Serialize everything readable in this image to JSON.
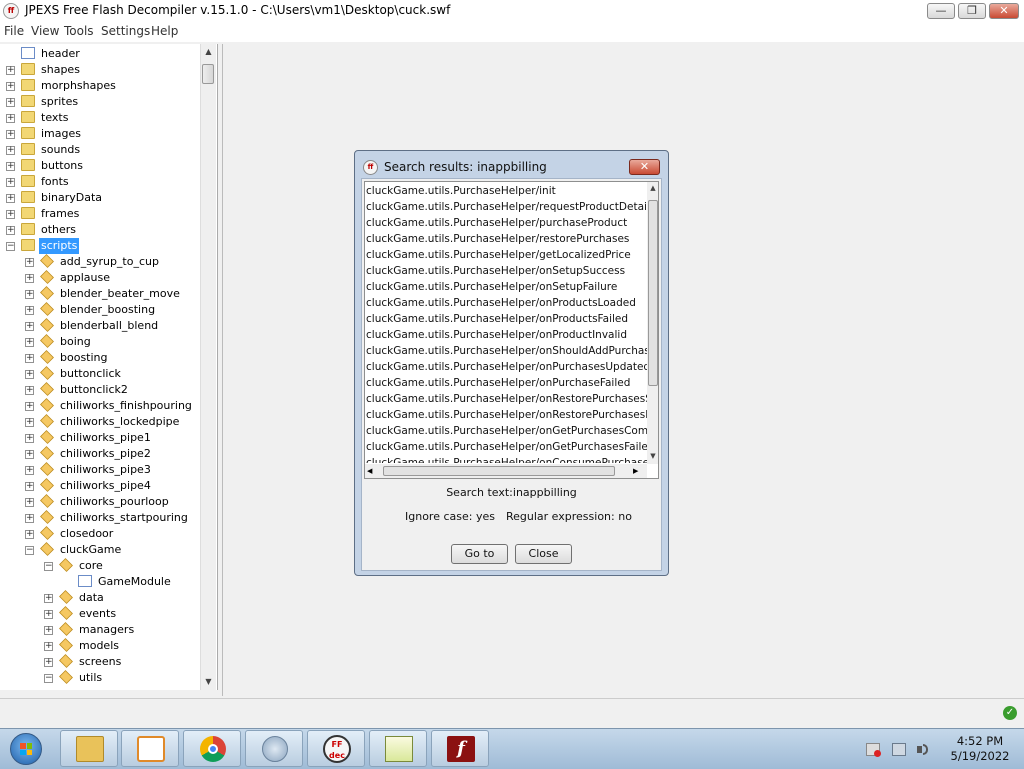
{
  "window": {
    "title": "JPEXS Free Flash Decompiler v.15.1.0 - C:\\Users\\vm1\\Desktop\\cuck.swf",
    "app_icon_text": "ff",
    "minimize": "—",
    "maximize": "❐",
    "close": "✕"
  },
  "menu": [
    "File",
    "View",
    "Tools",
    "Settings",
    "Help"
  ],
  "tree": {
    "nodes": [
      {
        "label": "header",
        "depth": 0,
        "expander": "",
        "icon": "doc"
      },
      {
        "label": "shapes",
        "depth": 0,
        "expander": "+",
        "icon": "folder"
      },
      {
        "label": "morphshapes",
        "depth": 0,
        "expander": "+",
        "icon": "folder"
      },
      {
        "label": "sprites",
        "depth": 0,
        "expander": "+",
        "icon": "folder"
      },
      {
        "label": "texts",
        "depth": 0,
        "expander": "+",
        "icon": "folder"
      },
      {
        "label": "images",
        "depth": 0,
        "expander": "+",
        "icon": "folder"
      },
      {
        "label": "sounds",
        "depth": 0,
        "expander": "+",
        "icon": "folder"
      },
      {
        "label": "buttons",
        "depth": 0,
        "expander": "+",
        "icon": "folder"
      },
      {
        "label": "fonts",
        "depth": 0,
        "expander": "+",
        "icon": "folder"
      },
      {
        "label": "binaryData",
        "depth": 0,
        "expander": "+",
        "icon": "folder"
      },
      {
        "label": "frames",
        "depth": 0,
        "expander": "+",
        "icon": "folder"
      },
      {
        "label": "others",
        "depth": 0,
        "expander": "+",
        "icon": "folder"
      },
      {
        "label": "scripts",
        "depth": 0,
        "expander": "−",
        "icon": "folder",
        "selected": true
      },
      {
        "label": "add_syrup_to_cup",
        "depth": 1,
        "expander": "+",
        "icon": "pkg"
      },
      {
        "label": "applause",
        "depth": 1,
        "expander": "+",
        "icon": "pkg"
      },
      {
        "label": "blender_beater_move",
        "depth": 1,
        "expander": "+",
        "icon": "pkg"
      },
      {
        "label": "blender_boosting",
        "depth": 1,
        "expander": "+",
        "icon": "pkg"
      },
      {
        "label": "blenderball_blend",
        "depth": 1,
        "expander": "+",
        "icon": "pkg"
      },
      {
        "label": "boing",
        "depth": 1,
        "expander": "+",
        "icon": "pkg"
      },
      {
        "label": "boosting",
        "depth": 1,
        "expander": "+",
        "icon": "pkg"
      },
      {
        "label": "buttonclick",
        "depth": 1,
        "expander": "+",
        "icon": "pkg"
      },
      {
        "label": "buttonclick2",
        "depth": 1,
        "expander": "+",
        "icon": "pkg"
      },
      {
        "label": "chiliworks_finishpouring",
        "depth": 1,
        "expander": "+",
        "icon": "pkg"
      },
      {
        "label": "chiliworks_lockedpipe",
        "depth": 1,
        "expander": "+",
        "icon": "pkg"
      },
      {
        "label": "chiliworks_pipe1",
        "depth": 1,
        "expander": "+",
        "icon": "pkg"
      },
      {
        "label": "chiliworks_pipe2",
        "depth": 1,
        "expander": "+",
        "icon": "pkg"
      },
      {
        "label": "chiliworks_pipe3",
        "depth": 1,
        "expander": "+",
        "icon": "pkg"
      },
      {
        "label": "chiliworks_pipe4",
        "depth": 1,
        "expander": "+",
        "icon": "pkg"
      },
      {
        "label": "chiliworks_pourloop",
        "depth": 1,
        "expander": "+",
        "icon": "pkg"
      },
      {
        "label": "chiliworks_startpouring",
        "depth": 1,
        "expander": "+",
        "icon": "pkg"
      },
      {
        "label": "closedoor",
        "depth": 1,
        "expander": "+",
        "icon": "pkg"
      },
      {
        "label": "cluckGame",
        "depth": 1,
        "expander": "−",
        "icon": "pkg"
      },
      {
        "label": "core",
        "depth": 2,
        "expander": "−",
        "icon": "pkg"
      },
      {
        "label": "GameModule",
        "depth": 3,
        "expander": "",
        "icon": "doc"
      },
      {
        "label": "data",
        "depth": 2,
        "expander": "+",
        "icon": "pkg"
      },
      {
        "label": "events",
        "depth": 2,
        "expander": "+",
        "icon": "pkg"
      },
      {
        "label": "managers",
        "depth": 2,
        "expander": "+",
        "icon": "pkg"
      },
      {
        "label": "models",
        "depth": 2,
        "expander": "+",
        "icon": "pkg"
      },
      {
        "label": "screens",
        "depth": 2,
        "expander": "+",
        "icon": "pkg"
      },
      {
        "label": "utils",
        "depth": 2,
        "expander": "−",
        "icon": "pkg"
      }
    ]
  },
  "dialog": {
    "title": "Search results: inappbilling",
    "close_label": "✕",
    "results": [
      "cluckGame.utils.PurchaseHelper/init",
      "cluckGame.utils.PurchaseHelper/requestProductDetails",
      "cluckGame.utils.PurchaseHelper/purchaseProduct",
      "cluckGame.utils.PurchaseHelper/restorePurchases",
      "cluckGame.utils.PurchaseHelper/getLocalizedPrice",
      "cluckGame.utils.PurchaseHelper/onSetupSuccess",
      "cluckGame.utils.PurchaseHelper/onSetupFailure",
      "cluckGame.utils.PurchaseHelper/onProductsLoaded",
      "cluckGame.utils.PurchaseHelper/onProductsFailed",
      "cluckGame.utils.PurchaseHelper/onProductInvalid",
      "cluckGame.utils.PurchaseHelper/onShouldAddPurchase",
      "cluckGame.utils.PurchaseHelper/onPurchasesUpdated",
      "cluckGame.utils.PurchaseHelper/onPurchaseFailed",
      "cluckGame.utils.PurchaseHelper/onRestorePurchasesSucce",
      "cluckGame.utils.PurchaseHelper/onRestorePurchasesFailed",
      "cluckGame.utils.PurchaseHelper/onGetPurchasesComplete",
      "cluckGame.utils.PurchaseHelper/onGetPurchasesFailed",
      "cluckGame.utils.PurchaseHelper/onConsumePurchaseSucc"
    ],
    "search_text": "Search text:inappbilling",
    "ignore_case": "Ignore case: yes",
    "regex": "Regular expression: no",
    "goto_label": "Go to",
    "close_button_label": "Close"
  },
  "taskbar": {
    "clock_time": "4:52 PM",
    "clock_date": "5/19/2022",
    "ffdec_label": "FF\ndec"
  },
  "colors": {
    "selection": "#3399ff",
    "dialog_frame": "#c4d3e6",
    "close_red": "#c94a33",
    "taskbar": "#b1c8df"
  }
}
